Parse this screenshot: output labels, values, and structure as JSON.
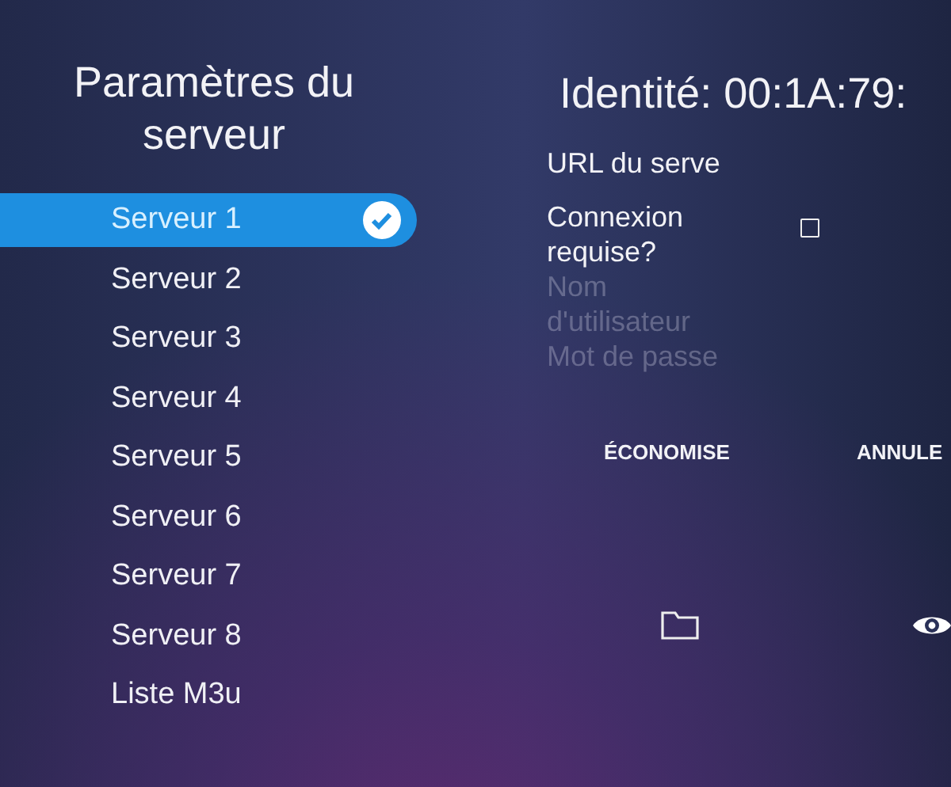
{
  "sidebar": {
    "title": "Paramètres du serveur",
    "items": [
      {
        "label": "Serveur 1",
        "selected": true
      },
      {
        "label": "Serveur 2",
        "selected": false
      },
      {
        "label": "Serveur 3",
        "selected": false
      },
      {
        "label": "Serveur 4",
        "selected": false
      },
      {
        "label": "Serveur 5",
        "selected": false
      },
      {
        "label": "Serveur 6",
        "selected": false
      },
      {
        "label": "Serveur 7",
        "selected": false
      },
      {
        "label": "Serveur 8",
        "selected": false
      },
      {
        "label": "Liste M3u",
        "selected": false
      }
    ]
  },
  "identity": "Identité: 00:1A:79:",
  "form": {
    "url_label": "URL du serve",
    "login_label": "Connexion requise?",
    "login_required": false,
    "username_placeholder": "Nom d'utilisateur",
    "password_placeholder": "Mot de passe"
  },
  "buttons": [
    "ÉCONOMISE",
    "ANNULE"
  ]
}
